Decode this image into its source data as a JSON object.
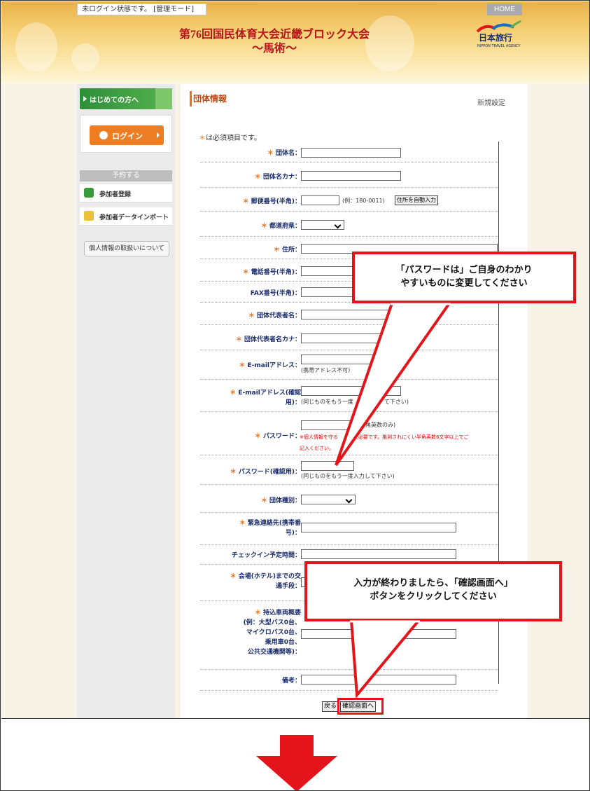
{
  "header": {
    "status": "未ログイン状態です。 [管理モード]",
    "home": "HOME",
    "title_line1": "第76回国民体育大会近畿ブロック大会",
    "title_line2": "～馬術～",
    "logo_text": "日本旅行",
    "logo_sub": "NIPPON TRAVEL AGENCY"
  },
  "sidebar": {
    "first_visit": "はじめての方へ",
    "login": "ログイン",
    "reserve_head": "予約する",
    "items": [
      "参加者登録",
      "参加者データインポート"
    ],
    "privacy": "個人情報の取扱いについて"
  },
  "main": {
    "section_title": "団体情報",
    "section_right": "新規設定",
    "required_note": "は必須項目です。",
    "star": "＊",
    "fields": {
      "group_name": "団体名：",
      "group_kana": "団体名カナ：",
      "postal": "郵便番号(半角)：",
      "postal_hint": "(例：180-0011)",
      "postal_btn": "住所を自動入力",
      "prefecture": "都道府県：",
      "address": "住所：",
      "phone": "電話番号(半角)：",
      "fax": "FAX番号(半角)：",
      "rep": "団体代表者名：",
      "rep_kana": "団体代表者名カナ：",
      "email": "E-mailアドレス：",
      "email_hint": "(携帯アドレス不可)",
      "email_confirm_1": "E-mailアドレス(確認",
      "email_confirm_2": "用)：",
      "email_confirm_hint": "(同じものをもう一度",
      "email_confirm_hint2": "て下さい)",
      "password": "パスワード：",
      "password_hint": "角英数のみ)",
      "password_warn1": "※個人情報を守る",
      "password_warn1b": "に必要です。推測されにくい半角英数6文字以上でご",
      "password_warn2": "記入ください。",
      "password_confirm": "パスワード(確認用)：",
      "password_confirm_hint": "(同じものをもう一度入力して下さい)",
      "group_type": "団体種別：",
      "emergency_1": "緊急連絡先(携帯番",
      "emergency_2": "号)：",
      "checkin": "チェックイン予定時間：",
      "transport_1": "会場(ホテル)までの交",
      "transport_2": "通手段：",
      "vehicles_1": "持込車両概要",
      "vehicles_2": "(例：大型バス0台、",
      "vehicles_3": "マイクロバス0台、",
      "vehicles_4": "乗用車0台、",
      "vehicles_5": "公共交通機関等)：",
      "remarks": "備考："
    },
    "back_btn": "戻る",
    "confirm_btn": "確認画面へ"
  },
  "callouts": {
    "password_1": "「パスワードは」ご自身のわかり",
    "password_2": "やすいものに変更してください",
    "confirm_1": "入力が終わりましたら、「確認画面へ」",
    "confirm_2": "ボタンをクリックしてください"
  },
  "colors": {
    "callout_red": "#e3151a",
    "title_red": "#b8141a",
    "accent_orange": "#e4721f",
    "label_navy": "#1a2d6e"
  }
}
